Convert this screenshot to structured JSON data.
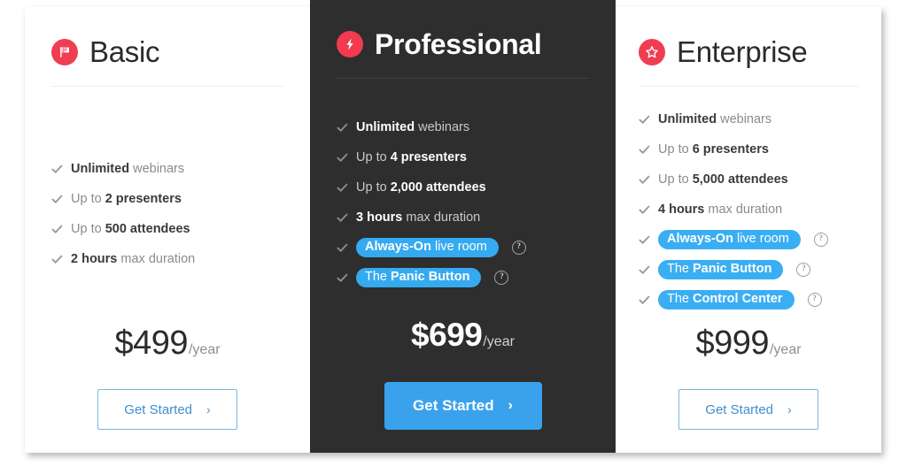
{
  "plans": [
    {
      "name": "Basic",
      "icon": "flag-icon",
      "theme": "light",
      "accent_color": "#ef3e52",
      "features": [
        {
          "prefix": "",
          "bold": "Unlimited",
          "suffix": " webinars",
          "highlight": false,
          "help": false
        },
        {
          "prefix": "Up to ",
          "bold": "2 presenters",
          "suffix": "",
          "highlight": false,
          "help": false
        },
        {
          "prefix": "Up to ",
          "bold": "500 attendees",
          "suffix": "",
          "highlight": false,
          "help": false
        },
        {
          "prefix": "",
          "bold": "2 hours",
          "suffix": " max duration",
          "highlight": false,
          "help": false
        }
      ],
      "price": "$499",
      "period": "/year",
      "cta_label": "Get Started",
      "cta_chevron": "›",
      "cta_style": "outline"
    },
    {
      "name": "Professional",
      "icon": "lightning-bolt-icon",
      "theme": "dark",
      "accent_color": "#f33a4e",
      "features": [
        {
          "prefix": "",
          "bold": "Unlimited",
          "suffix": " webinars",
          "highlight": false,
          "help": false
        },
        {
          "prefix": "Up to ",
          "bold": "4 presenters",
          "suffix": "",
          "highlight": false,
          "help": false
        },
        {
          "prefix": "Up to ",
          "bold": "2,000 attendees",
          "suffix": "",
          "highlight": false,
          "help": false
        },
        {
          "prefix": "",
          "bold": "3 hours",
          "suffix": " max duration",
          "highlight": false,
          "help": false
        },
        {
          "prefix": "",
          "bold": "Always-On",
          "suffix": " live room",
          "highlight": true,
          "help": true
        },
        {
          "prefix": "The ",
          "bold": "Panic Button",
          "suffix": "",
          "highlight": true,
          "help": true
        }
      ],
      "price": "$699",
      "period": "/year",
      "cta_label": "Get Started",
      "cta_chevron": "›",
      "cta_style": "solid"
    },
    {
      "name": "Enterprise",
      "icon": "star-icon",
      "theme": "light",
      "accent_color": "#ef3e52",
      "features": [
        {
          "prefix": "",
          "bold": "Unlimited",
          "suffix": " webinars",
          "highlight": false,
          "help": false
        },
        {
          "prefix": "Up to ",
          "bold": "6 presenters",
          "suffix": "",
          "highlight": false,
          "help": false
        },
        {
          "prefix": "Up to ",
          "bold": "5,000 attendees",
          "suffix": "",
          "highlight": false,
          "help": false
        },
        {
          "prefix": "",
          "bold": "4 hours",
          "suffix": " max duration",
          "highlight": false,
          "help": false
        },
        {
          "prefix": "",
          "bold": "Always-On",
          "suffix": " live room",
          "highlight": true,
          "help": true
        },
        {
          "prefix": "The ",
          "bold": "Panic Button",
          "suffix": "",
          "highlight": true,
          "help": true
        },
        {
          "prefix": "The ",
          "bold": "Control Center",
          "suffix": "",
          "highlight": true,
          "help": true
        }
      ],
      "price": "$999",
      "period": "/year",
      "cta_label": "Get Started",
      "cta_chevron": "›",
      "cta_style": "outline"
    }
  ],
  "help_glyph": "?",
  "colors": {
    "highlight_blue": "#35aaf0",
    "cta_blue": "#3aa2ec",
    "cta_outline_border": "#7cb6de",
    "cta_outline_text": "#3f8fd0",
    "dark_panel": "#2e2e2e",
    "icon_red": "#ef3e52",
    "check_gray": "#9a9a9a",
    "feature_text": "#8b8b8b",
    "feature_bold": "#3a3a3a"
  }
}
